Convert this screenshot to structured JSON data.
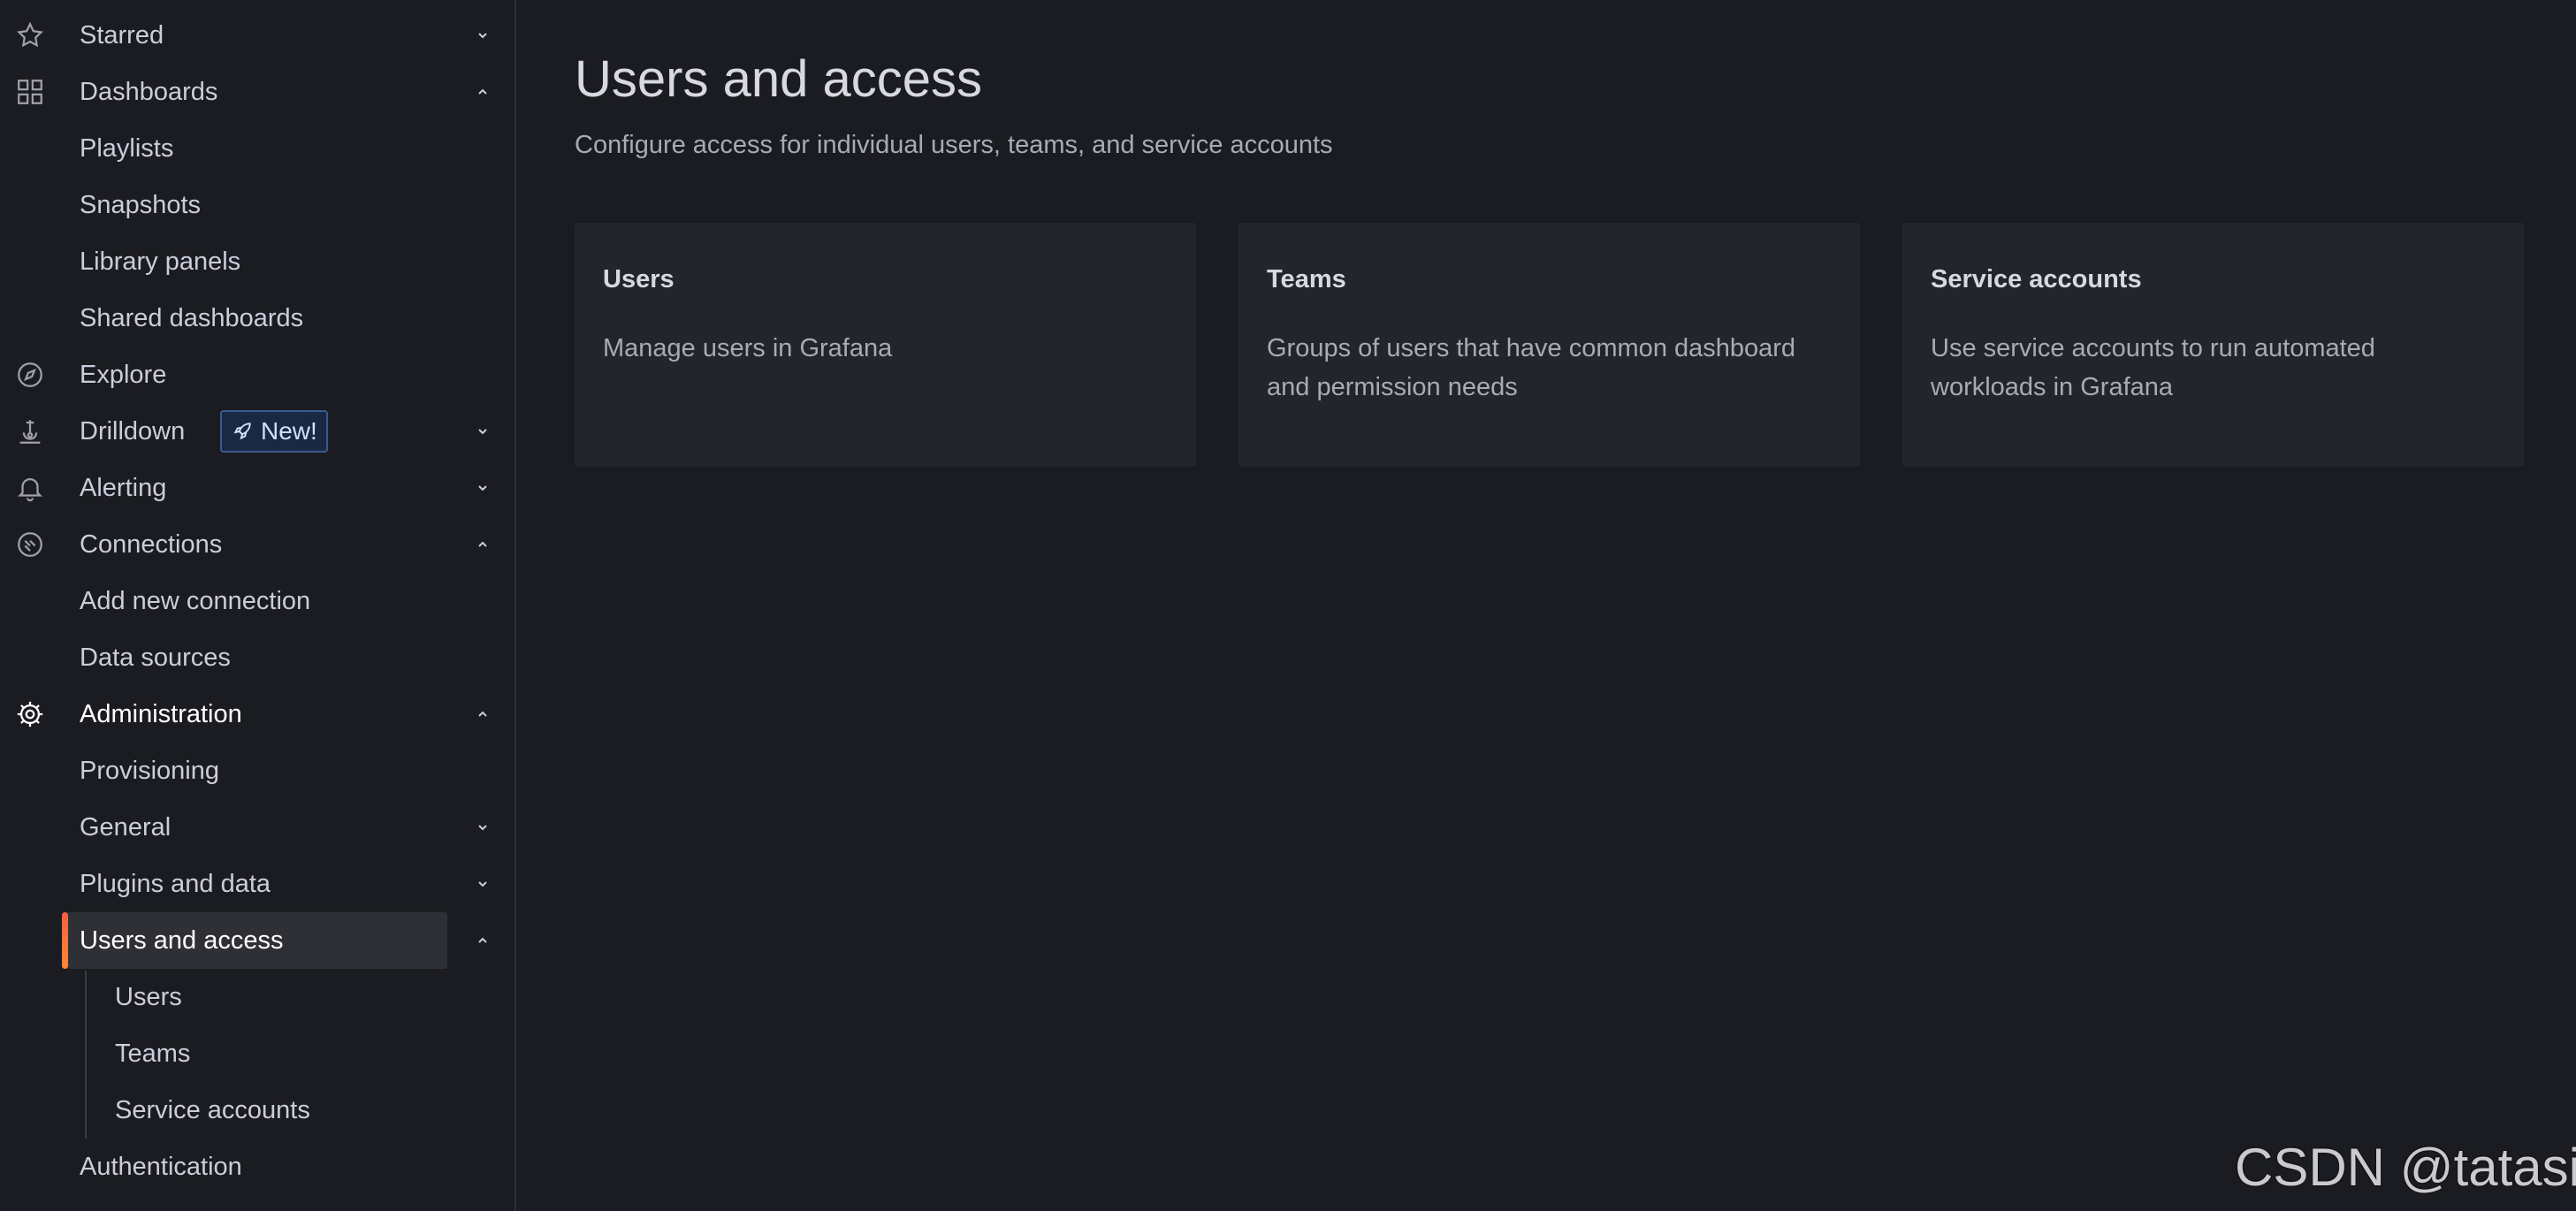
{
  "sidebar": {
    "starred": "Starred",
    "dashboards": "Dashboards",
    "playlists": "Playlists",
    "snapshots": "Snapshots",
    "library_panels": "Library panels",
    "shared_dashboards": "Shared dashboards",
    "explore": "Explore",
    "drilldown": "Drilldown",
    "drilldown_badge": "New!",
    "alerting": "Alerting",
    "connections": "Connections",
    "add_new_connection": "Add new connection",
    "data_sources": "Data sources",
    "administration": "Administration",
    "provisioning": "Provisioning",
    "general": "General",
    "plugins_and_data": "Plugins and data",
    "users_and_access": "Users and access",
    "users": "Users",
    "teams": "Teams",
    "service_accounts": "Service accounts",
    "authentication": "Authentication"
  },
  "main": {
    "title": "Users and access",
    "subtitle": "Configure access for individual users, teams, and service accounts",
    "cards": [
      {
        "title": "Users",
        "description": "Manage users in Grafana"
      },
      {
        "title": "Teams",
        "description": "Groups of users that have common dashboard and permission needs"
      },
      {
        "title": "Service accounts",
        "description": "Use service accounts to run automated workloads in Grafana"
      }
    ]
  },
  "watermark": "CSDN @tatasix",
  "colors": {
    "background": "#1b1c21",
    "card": "#22252b",
    "active_accent": "#ff8833",
    "badge_blue": "#3a5a94"
  }
}
